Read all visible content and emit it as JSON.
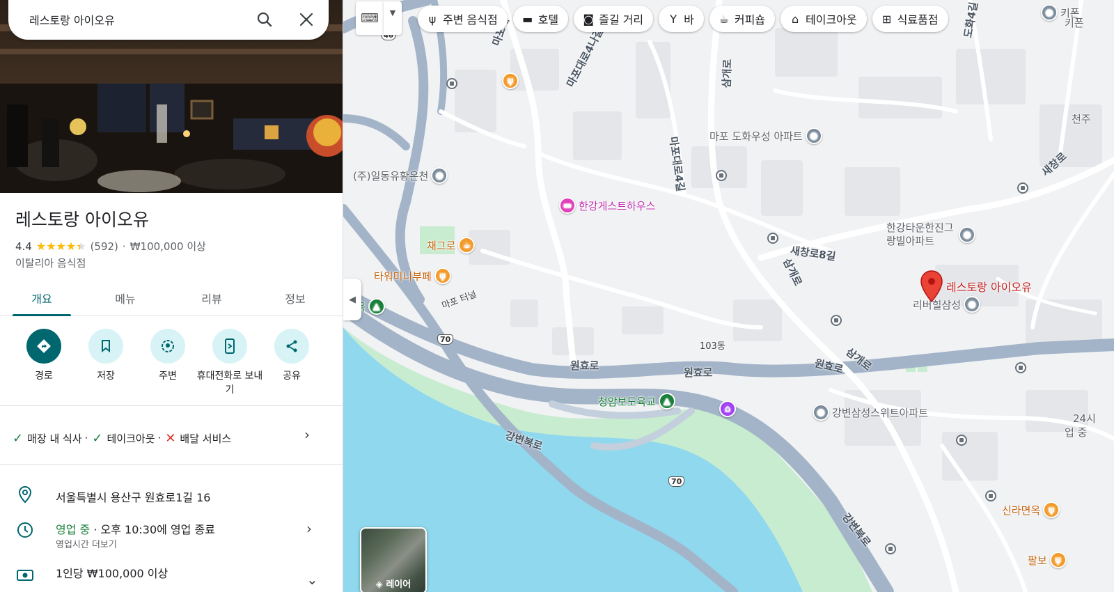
{
  "search": {
    "query": "레스토랑 아이오유"
  },
  "place": {
    "name": "레스토랑 아이오유",
    "rating": "4.4",
    "rating_value": 4.4,
    "reviews": "(592)",
    "price": "₩100,000 이상",
    "category": "이탈리아 음식점"
  },
  "tabs": [
    "개요",
    "메뉴",
    "리뷰",
    "정보"
  ],
  "actions": [
    "경로",
    "저장",
    "주변",
    "휴대전화로 보내기",
    "공유"
  ],
  "services": {
    "dine_in": "매장 내 식사",
    "takeout": "테이크아웃",
    "delivery": "배달 서비스",
    "sep": "·"
  },
  "info": {
    "address": "서울특별시 용산구 원효로1길 16",
    "hours_status": "영업 중",
    "hours_detail": "· 오후 10:30에 영업 종료",
    "hours_more": "영업시간 더보기",
    "price_line": "1인당 ₩100,000 이상"
  },
  "chips": [
    "주변 음식점",
    "호텔",
    "즐길 거리",
    "바",
    "커피숍",
    "테이크아웃",
    "식료품점"
  ],
  "map": {
    "pin_label": "레스토랑 아이오유",
    "layers_label": "레이어",
    "pois": {
      "dohwa": "마포 도화우성 아파트",
      "ildong": "(주)일동유황온천",
      "hangang_gh": "한강게스트하우스",
      "chaegeuro": "채그로",
      "tower": "타워미니부페",
      "dulmok": "들목",
      "hangang_town": "한강타운한진그랑빌아파트",
      "riverhill": "리버힐삼성",
      "cheongam": "청암보도육교",
      "gangbyeon_samsung": "강변삼성스위트아파트",
      "silla": "신라면옥",
      "palbo": "팔보",
      "kifon": "키폰",
      "kifon2": "키폰",
      "cheonju": "천주",
      "hours24": "24시",
      "hours24b": "업 중"
    },
    "roads": {
      "mapodaero4a": "마포대로4나길",
      "mapodaero4b": "마포대로4길",
      "mapodaero4c": "마포대",
      "samgaero1": "삼개로",
      "samgaero2": "삼개로",
      "samgaero3": "삼개로",
      "saechang8": "새창로8길",
      "saechang": "새창로",
      "wonhyo1": "원효로",
      "wonhyo2": "원효로",
      "wonhyo3": "원효로",
      "gangbyeon1": "강변북로",
      "gangbyeon2": "강변북로",
      "dohwa": "도화4길",
      "mapo_teo": "마포 터널"
    },
    "building_103": "103동",
    "shield_70": "70",
    "shield_46": "46"
  },
  "colors": {
    "accent": "#00676f",
    "accent_light": "#d7f3f6",
    "water": "#8fd8ee",
    "park": "#c8eccf",
    "road": "#a3b4c8",
    "pin": "#ea4335",
    "star": "#fbbc04"
  }
}
